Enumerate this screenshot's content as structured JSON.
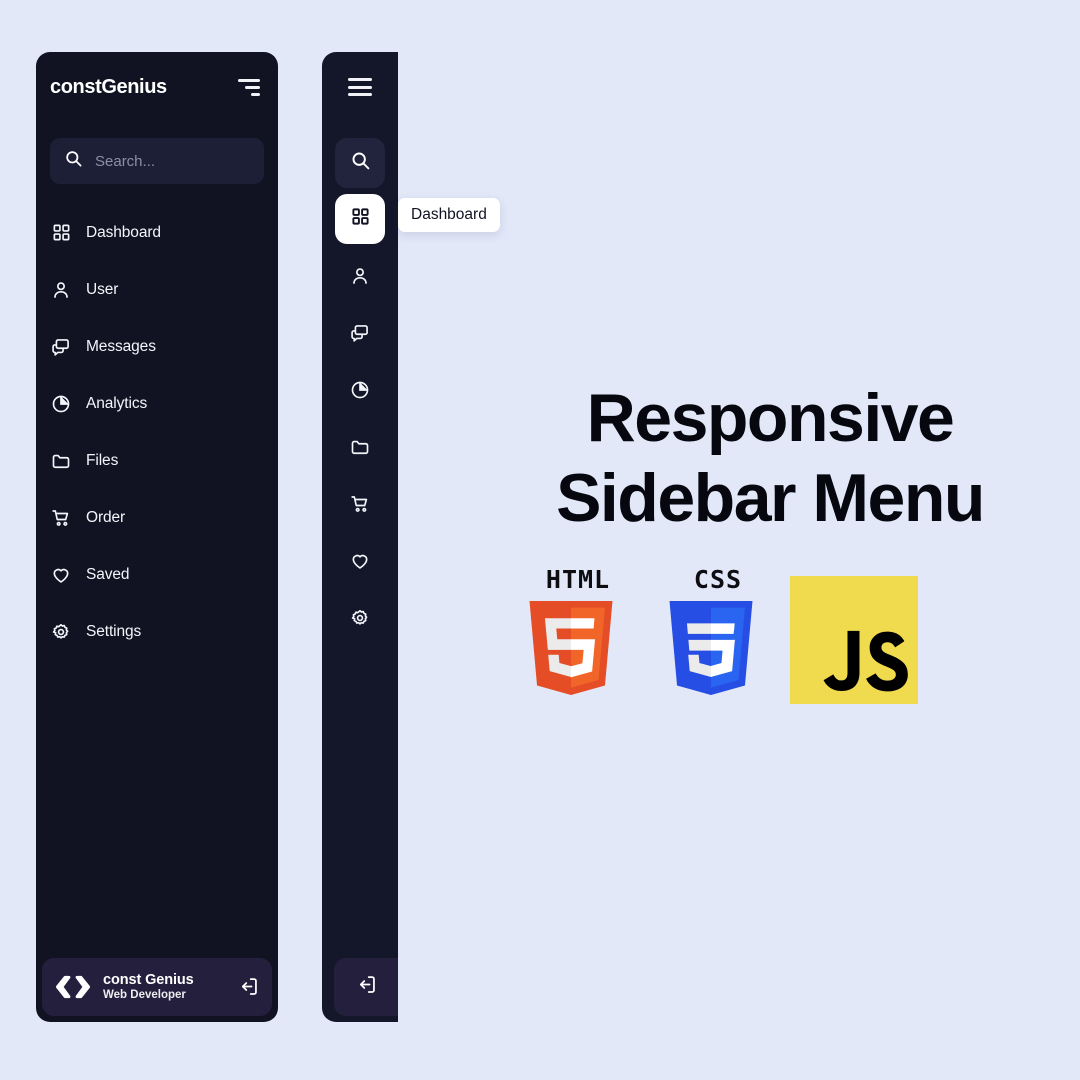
{
  "page": {
    "background_color": "#e2e8f8",
    "headline_lines": [
      "Responsive",
      "Sidebar Menu"
    ]
  },
  "sidebar_expanded": {
    "brand": "constGenius",
    "toggle_icon": "menu-collapse-icon",
    "search": {
      "placeholder": "Search...",
      "value": "",
      "icon": "search-icon"
    },
    "items": [
      {
        "label": "Dashboard",
        "icon": "grid-icon"
      },
      {
        "label": "User",
        "icon": "user-icon"
      },
      {
        "label": "Messages",
        "icon": "message-icon"
      },
      {
        "label": "Analytics",
        "icon": "pie-chart-icon"
      },
      {
        "label": "Files",
        "icon": "folder-icon"
      },
      {
        "label": "Order",
        "icon": "cart-icon"
      },
      {
        "label": "Saved",
        "icon": "heart-icon"
      },
      {
        "label": "Settings",
        "icon": "gear-icon"
      }
    ],
    "footer": {
      "avatar_icon": "code-brackets-icon",
      "name": "const Genius",
      "role": "Web Developer",
      "logout_icon": "logout-icon"
    }
  },
  "sidebar_collapsed": {
    "toggle_icon": "hamburger-icon",
    "search_icon": "search-icon",
    "active_item": "Dashboard",
    "items": [
      {
        "label": "Dashboard",
        "icon": "grid-icon",
        "active": true
      },
      {
        "label": "User",
        "icon": "user-icon",
        "active": false
      },
      {
        "label": "Messages",
        "icon": "message-icon",
        "active": false
      },
      {
        "label": "Analytics",
        "icon": "pie-chart-icon",
        "active": false
      },
      {
        "label": "Files",
        "icon": "folder-icon",
        "active": false
      },
      {
        "label": "Order",
        "icon": "cart-icon",
        "active": false
      },
      {
        "label": "Saved",
        "icon": "heart-icon",
        "active": false
      },
      {
        "label": "Settings",
        "icon": "gear-icon",
        "active": false
      }
    ],
    "footer": {
      "logout_icon": "logout-icon"
    }
  },
  "tooltip": {
    "text": "Dashboard"
  },
  "tech_logos": [
    {
      "name": "HTML",
      "caption": "HTML",
      "color": "#e44d26",
      "color_alt": "#f16529"
    },
    {
      "name": "CSS",
      "caption": "CSS",
      "color": "#1572b6",
      "color_alt": "#33a9dc"
    },
    {
      "name": "JS",
      "caption": "JS",
      "color": "#f0db4f",
      "color_alt": "#000000"
    }
  ],
  "colors": {
    "sidebar_bg": "#111322",
    "sidebar_mini_bg": "#14162a",
    "search_bg": "#1d1f37",
    "footer_bg": "#241f3d",
    "accent_white": "#ffffff",
    "page_bg": "#e2e8f8"
  }
}
